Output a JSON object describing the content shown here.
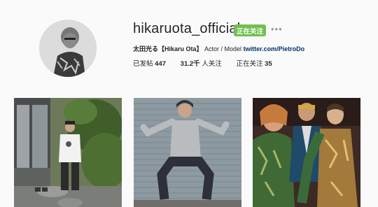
{
  "profile": {
    "username": "hikaruota_official",
    "follow_label": "正在关注",
    "more_label": "•••",
    "bio_name": "太田光る【Hikaru Ota】",
    "bio_role": "Actor / Model",
    "bio_link": "twitter.com/PietroDo"
  },
  "stats": {
    "posts_label": "已发帖",
    "posts_count": "447",
    "followers_count": "31.2千",
    "followers_label": "人关注",
    "following_label": "正在关注",
    "following_count": "35"
  },
  "colors": {
    "follow_button": "#70c050",
    "link": "#003569",
    "background": "#fafafa"
  },
  "icons": {
    "more": "more-dots-icon"
  }
}
